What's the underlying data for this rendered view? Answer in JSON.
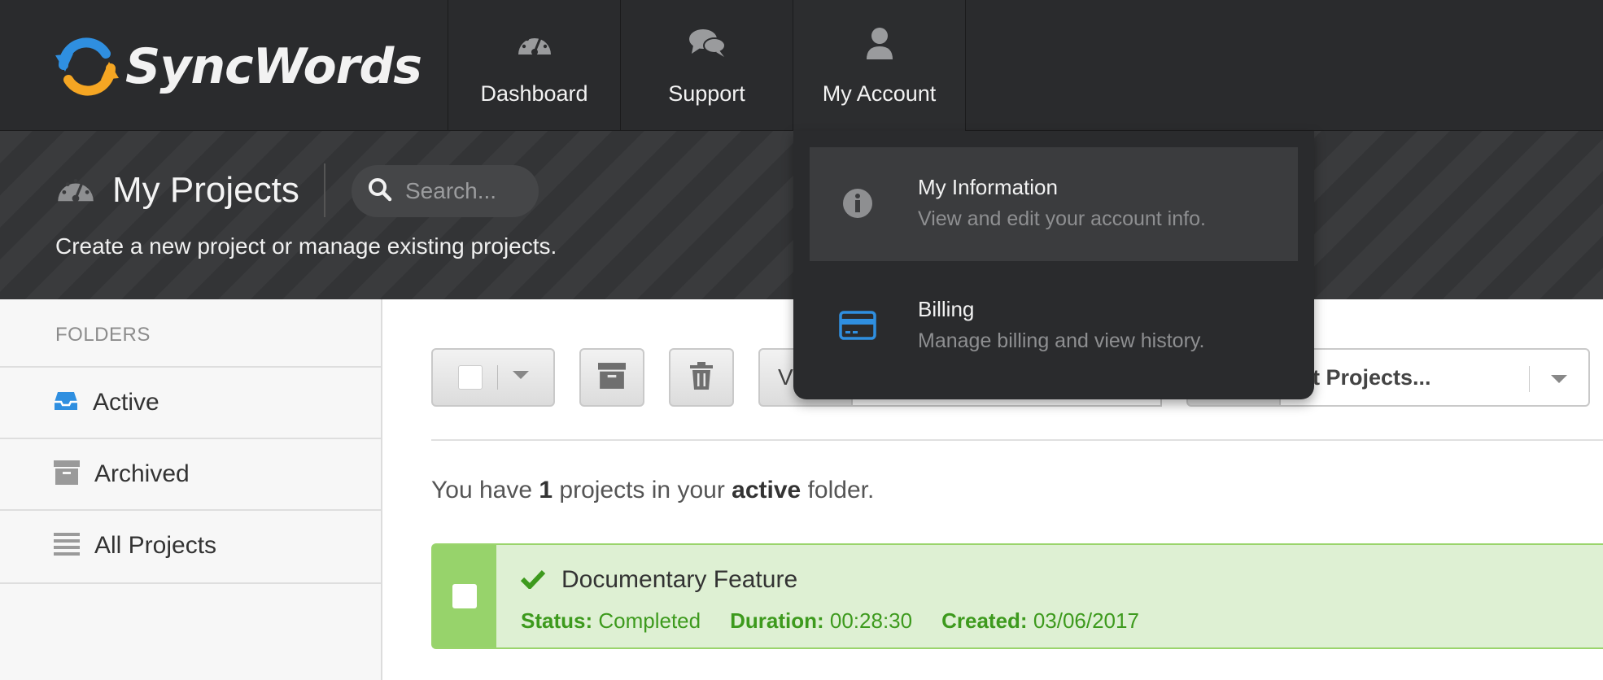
{
  "app": {
    "brand": "SyncWords"
  },
  "nav": {
    "items": [
      {
        "label": "Dashboard",
        "icon": "dashboard-gauge-icon"
      },
      {
        "label": "Support",
        "icon": "chat-bubbles-icon"
      },
      {
        "label": "My Account",
        "icon": "user-icon"
      }
    ]
  },
  "header": {
    "title": "My Projects",
    "subtitle": "Create a new project or manage existing projects.",
    "search_placeholder": "Search..."
  },
  "account_menu": {
    "items": [
      {
        "title": "My Information",
        "description": "View and edit your account info.",
        "icon": "info-circle-icon"
      },
      {
        "title": "Billing",
        "description": "Manage billing and view history.",
        "icon": "credit-card-icon"
      }
    ]
  },
  "sidebar": {
    "title": "FOLDERS",
    "items": [
      {
        "label": "Active",
        "icon": "inbox-icon"
      },
      {
        "label": "Archived",
        "icon": "archive-box-icon"
      },
      {
        "label": "All Projects",
        "icon": "list-lines-icon"
      }
    ]
  },
  "toolbar": {
    "view_prefix": "V",
    "sort_placeholder": "ort Projects..."
  },
  "summary": {
    "prefix": "You have",
    "count": "1",
    "middle": "projects in your",
    "folder": "active",
    "suffix": "folder."
  },
  "projects": [
    {
      "name": "Documentary Feature",
      "status_label": "Status:",
      "status": "Completed",
      "duration_label": "Duration:",
      "duration": "00:28:30",
      "created_label": "Created:",
      "created": "03/06/2017"
    }
  ],
  "colors": {
    "topbar": "#2a2b2d",
    "accent_blue": "#2f8fe0",
    "completed_green": "#3d9a1d",
    "completed_bg": "#def0d3"
  }
}
